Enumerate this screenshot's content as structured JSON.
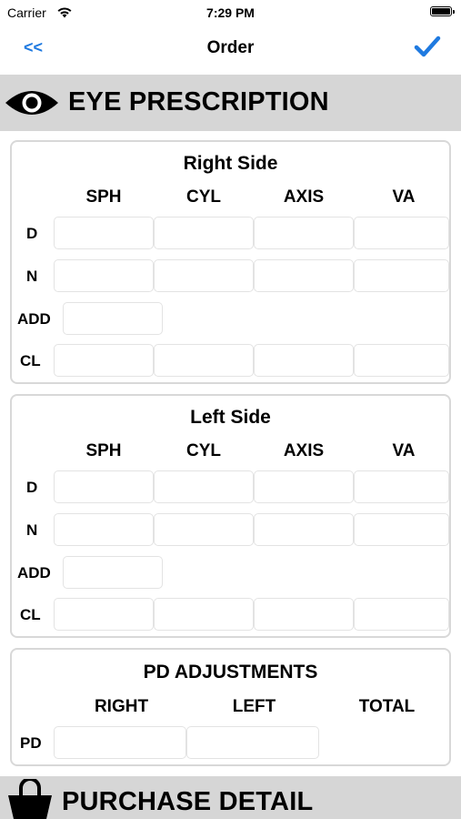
{
  "status_bar": {
    "carrier": "Carrier",
    "time": "7:29 PM"
  },
  "nav": {
    "back_label": "<<",
    "title": "Order"
  },
  "eye_section": {
    "title": "EYE PRESCRIPTION"
  },
  "right_side": {
    "title": "Right Side",
    "columns": [
      "SPH",
      "CYL",
      "AXIS",
      "VA"
    ],
    "rows": [
      "D",
      "N",
      "ADD",
      "CL"
    ]
  },
  "left_side": {
    "title": "Left Side",
    "columns": [
      "SPH",
      "CYL",
      "AXIS",
      "VA"
    ],
    "rows": [
      "D",
      "N",
      "ADD",
      "CL"
    ]
  },
  "pd": {
    "title": "PD ADJUSTMENTS",
    "columns": [
      "RIGHT",
      "LEFT",
      "TOTAL"
    ],
    "row_label": "PD"
  },
  "purchase_section": {
    "title": "PURCHASE DETAIL"
  }
}
